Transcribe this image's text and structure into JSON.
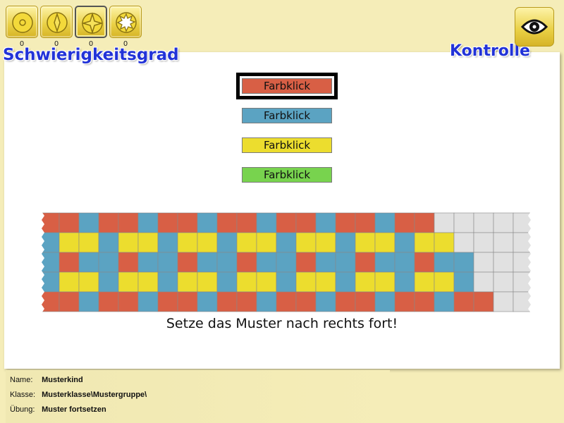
{
  "difficulty": {
    "title": "Schwierigkeitsgrad",
    "levels": [
      {
        "icon": "circle-level-icon",
        "count": "0"
      },
      {
        "icon": "diamond-level-icon",
        "count": "0"
      },
      {
        "icon": "star-level-icon",
        "count": "0"
      },
      {
        "icon": "burst-level-icon",
        "count": "0"
      }
    ],
    "selected_index": 2
  },
  "check": {
    "label": "Kontrolle",
    "icon": "eye-icon"
  },
  "color_buttons": [
    {
      "label": "Farbklick",
      "color": "#d85f45",
      "selected": true
    },
    {
      "label": "Farbklick",
      "color": "#5ba3c2",
      "selected": false
    },
    {
      "label": "Farbklick",
      "color": "#ecdd2e",
      "selected": false
    },
    {
      "label": "Farbklick",
      "color": "#78d34e",
      "selected": false
    }
  ],
  "colors": {
    "red": "#d85f45",
    "blue": "#5ba3c2",
    "yellow": "#ecdd2e",
    "empty": "#e1e1e1"
  },
  "pattern": {
    "rows": [
      "RRBRRBRRBRRBRRBRRBRREEEEE",
      "BYYBYYBYYBYYBYYBYYBYYEEEE",
      "BRBBRBBRBBRBBRBBRBBRBBEEE",
      "BYYBYYBYYBYYBYYBYYBYYBEEE",
      "RRBRRBRRBRRBRRBRRBRRBRREE"
    ]
  },
  "instruction": "Setze das Muster nach rechts fort!",
  "footer": {
    "name_label": "Name:",
    "name_value": "Musterkind",
    "class_label": "Klasse:",
    "class_value": "Musterklasse\\Mustergruppe\\",
    "exercise_label": "Übung:",
    "exercise_value": "Muster fortsetzen"
  }
}
